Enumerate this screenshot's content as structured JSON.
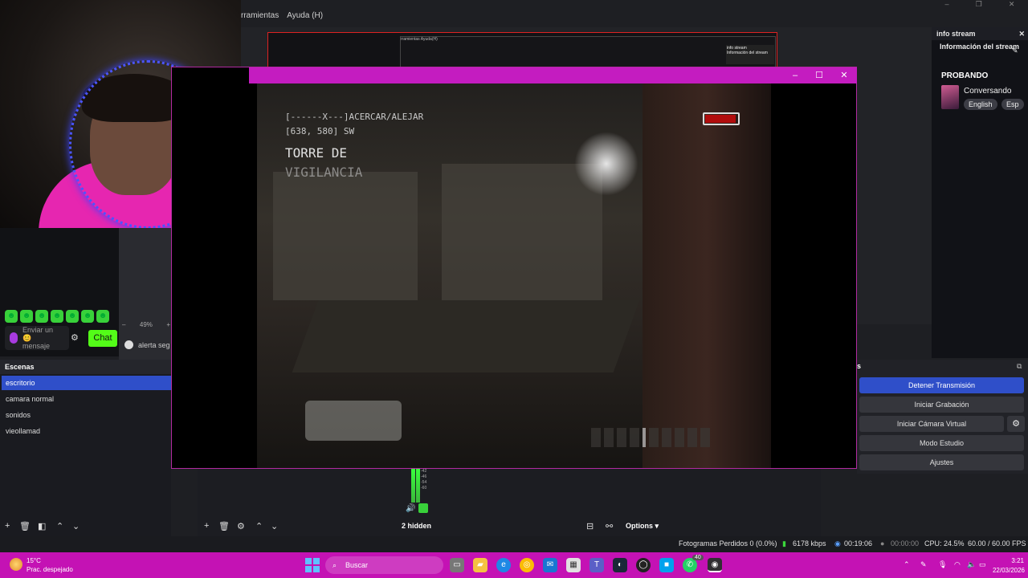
{
  "obs": {
    "menu": [
      "rramientas",
      "Ayuda (H)"
    ],
    "window_controls": [
      "–",
      "❐",
      "✕"
    ]
  },
  "nested_preview": {
    "menu": "rramientas Ayuda(H)",
    "dock_title": "info stream",
    "dock_text": "Información del stream"
  },
  "game": {
    "window_controls": [
      "–",
      "☐",
      "✕"
    ],
    "hud": {
      "zoom": "[------X---]ACERCAR/ALEJAR",
      "coords": "[638, 580] SW",
      "location_line1": "TORRE DE",
      "location_line2": "VIGILANCIA"
    },
    "battery_color": "#b10d0d"
  },
  "chat": {
    "emote_icons": [
      "kick-emote-icon",
      "kick-emote-icon",
      "kick-emote-icon",
      "kick-emote-icon",
      "kick-emote-icon",
      "kick-emote-icon",
      "kick-emote-icon"
    ],
    "placeholder": "Enviar un 😊 mensaje",
    "send_label": "Chat",
    "accent": "#53fc18"
  },
  "preview_tools": {
    "zoom_minus": "–",
    "zoom_value": "49%",
    "zoom_plus": "+",
    "alert_label": "alerta seg"
  },
  "info_stream": {
    "dock_title": "info stream",
    "panel_title": "Información del stream",
    "stream_title": "PROBANDO",
    "category": "Conversando",
    "languages": [
      "English",
      "Esp"
    ]
  },
  "controls": {
    "stop_stream": "Detener Transmisión",
    "start_recording": "Iniciar Grabación",
    "virtual_camera": "Iniciar Cámara Virtual",
    "studio_mode": "Modo Estudio",
    "settings": "Ajustes",
    "header_letters": "s",
    "accent": "#2f4fc9"
  },
  "scenes": {
    "title": "Escenas",
    "items": [
      "escritorio",
      "camara normal",
      "sonidos",
      "vieollamad"
    ],
    "active_index": 0
  },
  "mixer": {
    "meter_labels": [
      "-42",
      "-46",
      "-54",
      "-60"
    ],
    "hidden_label": "2 hidden",
    "options_label": "Options"
  },
  "status": {
    "dropped_frames": "Fotogramas Perdidos 0 (0.0%)",
    "bitrate": "6178 kbps",
    "stream_time": "00:19:06",
    "record_time": "00:00:00",
    "cpu": "CPU: 24.5%",
    "fps": "60.00 / 60.00 FPS"
  },
  "taskbar": {
    "weather_temp": "15°C",
    "weather_desc": "Prac. despejado",
    "search_placeholder": "Buscar",
    "whatsapp_badge": "40",
    "time": "3:21",
    "date": "22/03/2026"
  }
}
